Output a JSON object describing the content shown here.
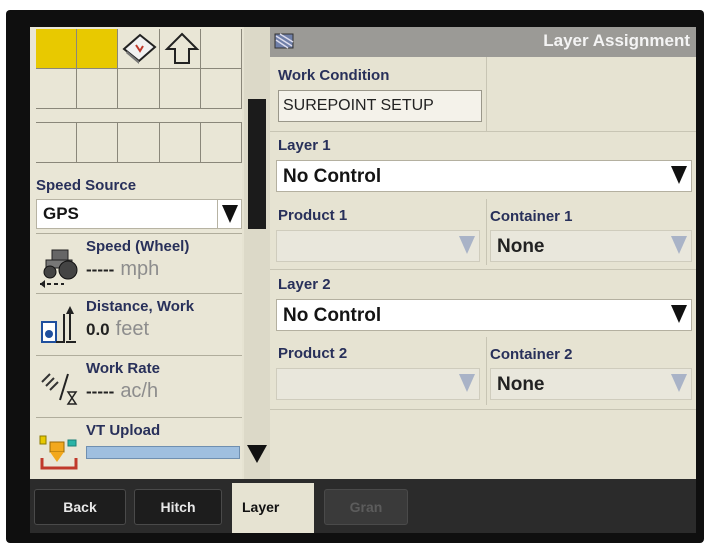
{
  "left_panel": {
    "speed_source": {
      "label": "Speed Source",
      "value": "GPS"
    },
    "speed": {
      "title": "Speed (Wheel)",
      "value": "-----",
      "unit": "mph"
    },
    "distance": {
      "title": "Distance, Work",
      "value": "0.0",
      "unit": "feet"
    },
    "work_rate": {
      "title": "Work Rate",
      "value": "-----",
      "unit": "ac/h"
    },
    "vt_upload": {
      "title": "VT Upload",
      "progress": 1.0
    }
  },
  "header": {
    "title": "Layer Assignment"
  },
  "work_condition": {
    "label": "Work Condition",
    "value": "SUREPOINT SETUP"
  },
  "layer1": {
    "label": "Layer 1",
    "value": "No Control",
    "product_label": "Product 1",
    "product_value": "",
    "container_label": "Container 1",
    "container_value": "None"
  },
  "layer2": {
    "label": "Layer 2",
    "value": "No Control",
    "product_label": "Product 2",
    "product_value": "",
    "container_label": "Container 2",
    "container_value": "None"
  },
  "tabs": [
    {
      "label": "Back"
    },
    {
      "label": "Hitch"
    },
    {
      "label": "Layer"
    },
    {
      "label": "Gran"
    }
  ],
  "colors": {
    "accent_yellow": "#e8c900",
    "label_blue": "#28305a",
    "header_gray": "#9b9a96",
    "screen_bg": "#e6e3d2"
  },
  "icons": [
    "page-icon",
    "arrow-up-icon",
    "tractor-icon",
    "distance-icon",
    "work-rate-icon",
    "vt-upload-icon",
    "header-icon"
  ]
}
